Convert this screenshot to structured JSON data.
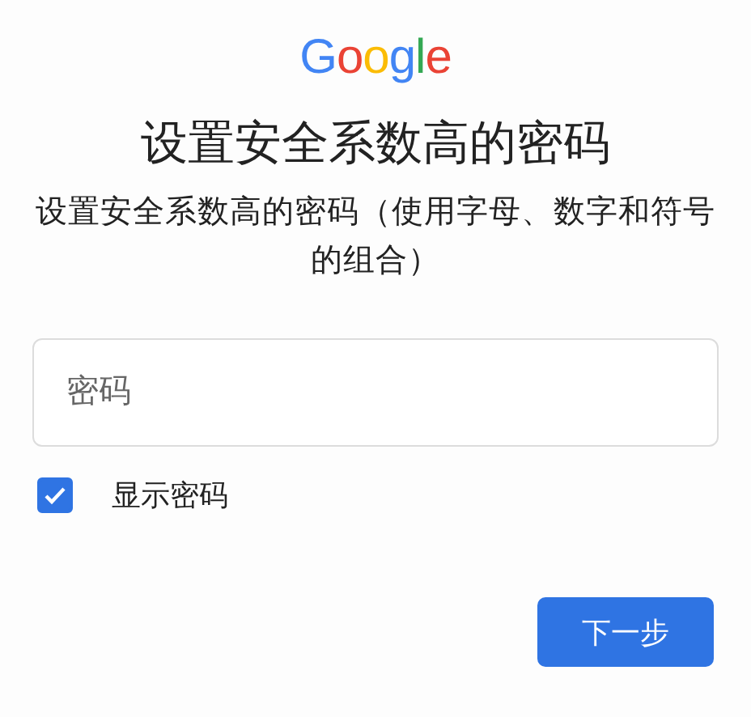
{
  "logo": "Google",
  "title": "设置安全系数高的密码",
  "subtitle": "设置安全系数高的密码（使用字母、数字和符号的组合）",
  "password_field": {
    "placeholder": "密码"
  },
  "show_password": {
    "label": "显示密码",
    "checked": true
  },
  "next_button": "下一步"
}
